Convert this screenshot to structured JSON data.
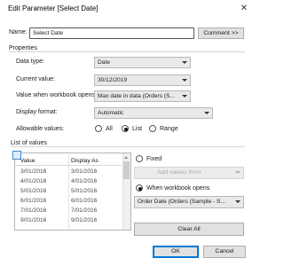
{
  "dialog": {
    "title": "Edit Parameter [Select Date]",
    "close_glyph": "✕"
  },
  "name_row": {
    "label": "Name:",
    "value": "Select Date",
    "comment_button": "Comment >>"
  },
  "properties": {
    "header": "Properties",
    "data_type": {
      "label": "Data type:",
      "value": "Date"
    },
    "current_value": {
      "label": "Current value:",
      "value": "30/12/2019"
    },
    "on_open": {
      "label": "Value when workbook opens:",
      "value": "Max date in data (Orders (S..."
    },
    "display_format": {
      "label": "Display format:",
      "value": "Automatic"
    },
    "allowable": {
      "label": "Allowable values:",
      "options": [
        "All",
        "List",
        "Range"
      ],
      "selected": "List"
    }
  },
  "list_of_values": {
    "header": "List of values",
    "columns": [
      "Value",
      "Display As"
    ],
    "rows": [
      [
        "3/01/2016",
        "3/01/2016"
      ],
      [
        "4/01/2016",
        "4/01/2016"
      ],
      [
        "5/01/2016",
        "5/01/2016"
      ],
      [
        "6/01/2016",
        "6/01/2016"
      ],
      [
        "7/01/2016",
        "7/01/2016"
      ],
      [
        "9/01/2016",
        "9/01/2016"
      ]
    ],
    "fixed_label": "Fixed",
    "add_values_from": "Add values from",
    "when_opens_label": "When workbook opens",
    "source_select": "Order Date (Orders (Sample - S...",
    "clear_all": "Clear All"
  },
  "footer": {
    "ok": "OK",
    "cancel": "Cancel"
  },
  "colors": {
    "accent": "#0078d7",
    "separator": "#d4d4d4"
  }
}
